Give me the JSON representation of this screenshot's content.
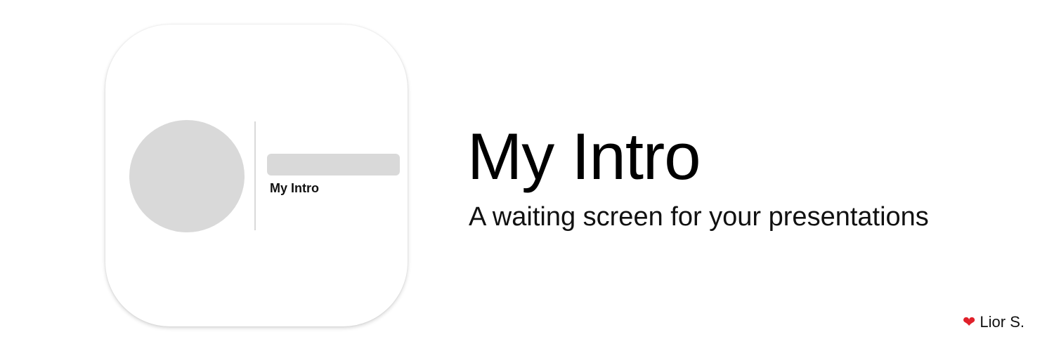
{
  "icon_preview": {
    "caption": "My Intro"
  },
  "hero": {
    "title": "My Intro",
    "subtitle": "A waiting screen for your presentations"
  },
  "credit": {
    "icon": "heart-icon",
    "author": "Lior S."
  },
  "colors": {
    "background": "#ffffff",
    "placeholder_gray": "#d9d9d9",
    "heart": "#e0202a",
    "text": "#000000"
  }
}
